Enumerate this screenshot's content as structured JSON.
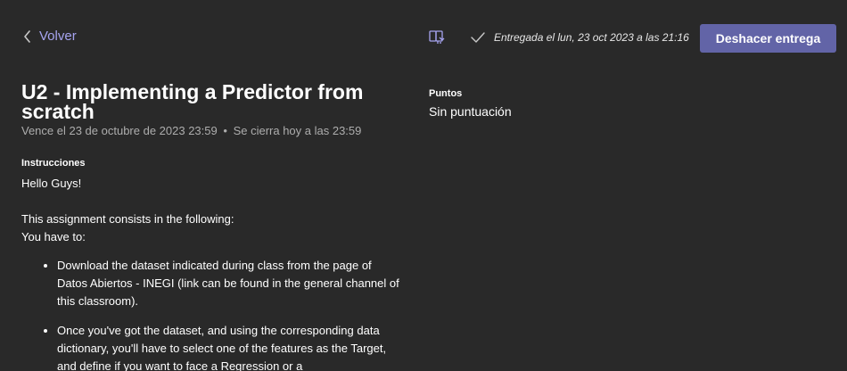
{
  "header": {
    "back_label": "Volver",
    "turned_in_text": "Entregada el lun, 23 oct 2023 a las 21:16",
    "undo_button_label": "Deshacer entrega"
  },
  "assignment": {
    "title": "U2 - Implementing a Predictor from scratch",
    "due_text": "Vence el 23 de octubre de 2023 23:59",
    "separator": "•",
    "closes_text": "Se cierra hoy a las 23:59",
    "instructions_label": "Instrucciones",
    "instructions": {
      "greeting": "Hello Guys!",
      "intro": "This assignment consists in the following:",
      "lead": "You have to:",
      "bullets": [
        "Download the dataset indicated during class from the page of Datos Abiertos - INEGI (link can be found in the general channel of this classroom).",
        "Once you've got the dataset, and using the corresponding data dictionary, you'll have to select one of the features as the Target, and define if you want to face a Regression or a"
      ]
    }
  },
  "points": {
    "label": "Puntos",
    "value": "Sin puntuación"
  },
  "colors": {
    "background": "#292929",
    "accent": "#6264a7",
    "back_link": "#a6a4f0",
    "secondary_text": "#adadad"
  },
  "icons": {
    "back": "chevron-left-icon",
    "reader": "immersive-reader-icon",
    "status": "checkmark-icon"
  }
}
